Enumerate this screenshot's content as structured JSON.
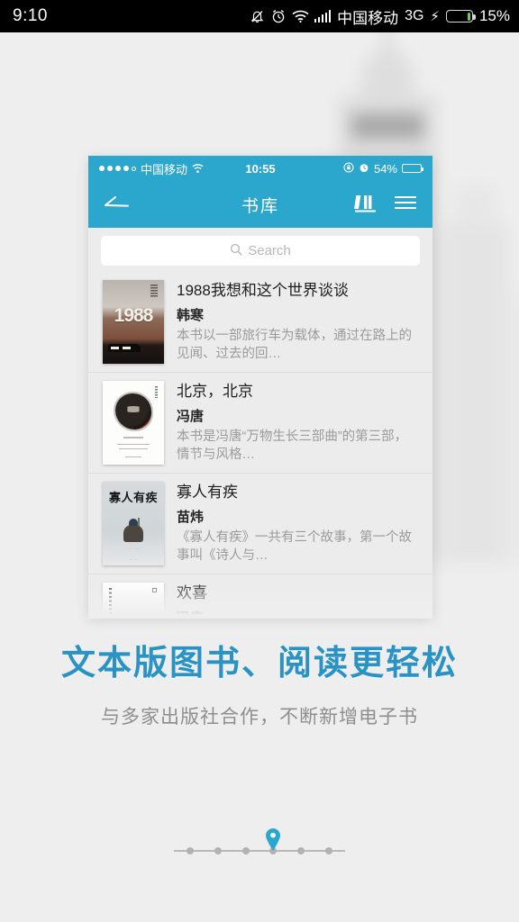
{
  "system_status_bar": {
    "clock": "9:10",
    "carrier": "中国移动",
    "network": "3G",
    "battery_percent": "15%",
    "icons": [
      "mute-icon",
      "alarm-icon",
      "wifi-icon",
      "signal-bars-icon",
      "charging-bolt-icon",
      "battery-icon"
    ]
  },
  "phone_mockup": {
    "ios_status_bar": {
      "carrier": "中国移动",
      "time": "10:55",
      "battery_percent": "54%",
      "icons": [
        "signal-dots-icon",
        "wifi-icon",
        "rotation-lock-icon",
        "alarm-icon",
        "battery-icon"
      ]
    },
    "navbar": {
      "back_label": "",
      "title": "书库",
      "bookshelf_icon": "bookshelf-icon",
      "menu_icon": "hamburger-menu-icon"
    },
    "search": {
      "placeholder": "Search",
      "value": "",
      "icon": "search-icon"
    },
    "books": [
      {
        "title": "1988我想和这个世界谈谈",
        "author": "韩寒",
        "description": "本书以一部旅行车为载体，通过在路上的见闻、过去的回…",
        "cover_text": "1988"
      },
      {
        "title": "北京，北京",
        "author": "冯唐",
        "description": "本书是冯唐“万物生长三部曲”的第三部，情节与风格…",
        "cover_text": ""
      },
      {
        "title": "寡人有疾",
        "author": "苗炜",
        "description": "《寡人有疾》一共有三个故事，第一个故事叫《诗人与…",
        "cover_text": "寡人有疾"
      },
      {
        "title": "欢喜",
        "author": "冯唐",
        "description": "",
        "cover_text": ""
      }
    ]
  },
  "promo": {
    "headline": "文本版图书、阅读更轻松",
    "subline": "与多家出版社合作，不断新增电子书"
  },
  "pager": {
    "total": 6,
    "current": 4
  },
  "colors": {
    "accent": "#2ba7cd",
    "headline": "#2a93c4",
    "page_background": "#eeeeee",
    "battery_green": "#6fd14b"
  }
}
